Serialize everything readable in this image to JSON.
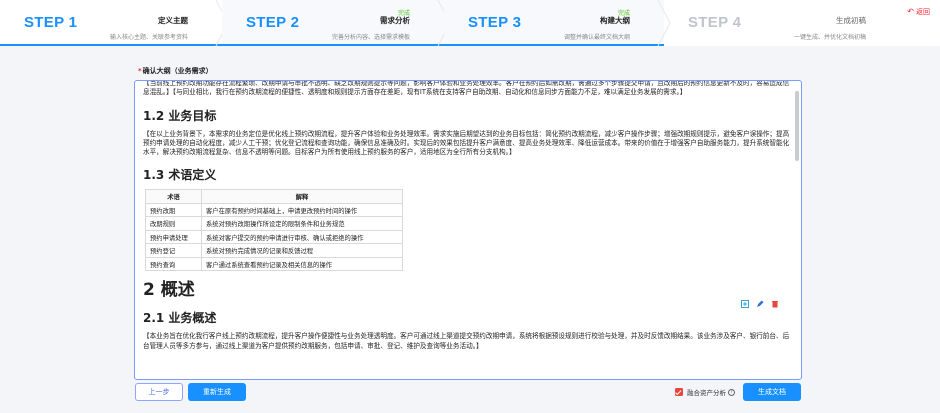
{
  "steps": [
    {
      "num": "STEP 1",
      "title": "定义主题",
      "status": "",
      "desc": "输入核心主题、关联参考资料"
    },
    {
      "num": "STEP 2",
      "title": "需求分析",
      "status": "完成",
      "desc": "完善分析内容、选择需求模板"
    },
    {
      "num": "STEP 3",
      "title": "构建大纲",
      "status": "完成",
      "desc": "调整并确认最终文档大纲"
    },
    {
      "num": "STEP 4",
      "title": "生成初稿",
      "status": "",
      "desc": "一键生成、并优化文档初稿"
    }
  ],
  "nav": {
    "back_label": "返回"
  },
  "outline": {
    "title": "确认大纲（业务需求）",
    "intro": "【当前线上预约改期功能存在流程繁琐、改期申请与审批不透明、缺乏改期规则提示等问题，影响客户体验和业务处理效率。客户在预约后如需改期，需通过多个步骤提交申请，且改期后的预约信息更新不及时，容易造成信息混乱。】【与同业相比，我行在预约改期流程的便捷性、透明度和规则提示方面存在差距，现有IT系统在支持客户自助改期、自动化和信息同步方面能力不足，难以满足业务发展的需求。】",
    "h_goal": "1.2 业务目标",
    "goal": "【在以上业务背景下，本需求的业务定位是优化线上预约改期流程，提升客户体验和业务处理效率。需求实施后期望达到的业务目标包括：简化预约改期流程，减少客户操作步骤；增强改期规则提示，避免客户误操作；提高预约申请处理的自动化程度，减少人工干预；优化登记流程和查询功能，确保信息准确及时。实现后的效果包括提升客户满意度、提高业务处理效率、降低运营成本。带来的价值在于增强客户自助服务能力，提升系统智能化水平，解决预约改期流程复杂、信息不透明等问题。目标客户为所有使用线上预约服务的客户，适用地区为全行所有分支机构。】",
    "h_terms": "1.3 术语定义",
    "terms_head": [
      "术语",
      "解释"
    ],
    "terms": [
      {
        "term": "预约改期",
        "desc": "客户在原有预约时间基础上，申请更改预约时间的操作"
      },
      {
        "term": "改期规则",
        "desc": "系统对预约改期操作所设定的限制条件和业务规范"
      },
      {
        "term": "预约申请处理",
        "desc": "系统对客户提交的预约申请进行审核、确认或拒绝的操作"
      },
      {
        "term": "预约登记",
        "desc": "系统对预约完成情况的记录和反馈过程"
      },
      {
        "term": "预约查询",
        "desc": "客户通过系统查看预约记录及相关信息的操作"
      }
    ],
    "h_overview": "2 概述",
    "h_biz": "2.1 业务概述",
    "biz": "【本业务旨在优化我行客户线上预约改期流程，提升客户操作便捷性与业务处理透明度。客户可通过线上渠道提交预约改期申请，系统将根据预设规则进行校验与处理，并及时反馈改期结果。该业务涉及客户、银行前台、后台管理人员等多方参与，通过线上渠道为客户提供预约改期服务，包括申请、审批、登记、维护及查询等业务活动。】"
  },
  "footer": {
    "prev": "上一步",
    "regen": "重新生成",
    "fuse_label": "融合资产分析",
    "fuse_checked": true,
    "generate": "生成文档"
  },
  "colors": {
    "accent": "#1890ff",
    "done": "#52c41a",
    "danger": "#f5222d"
  }
}
